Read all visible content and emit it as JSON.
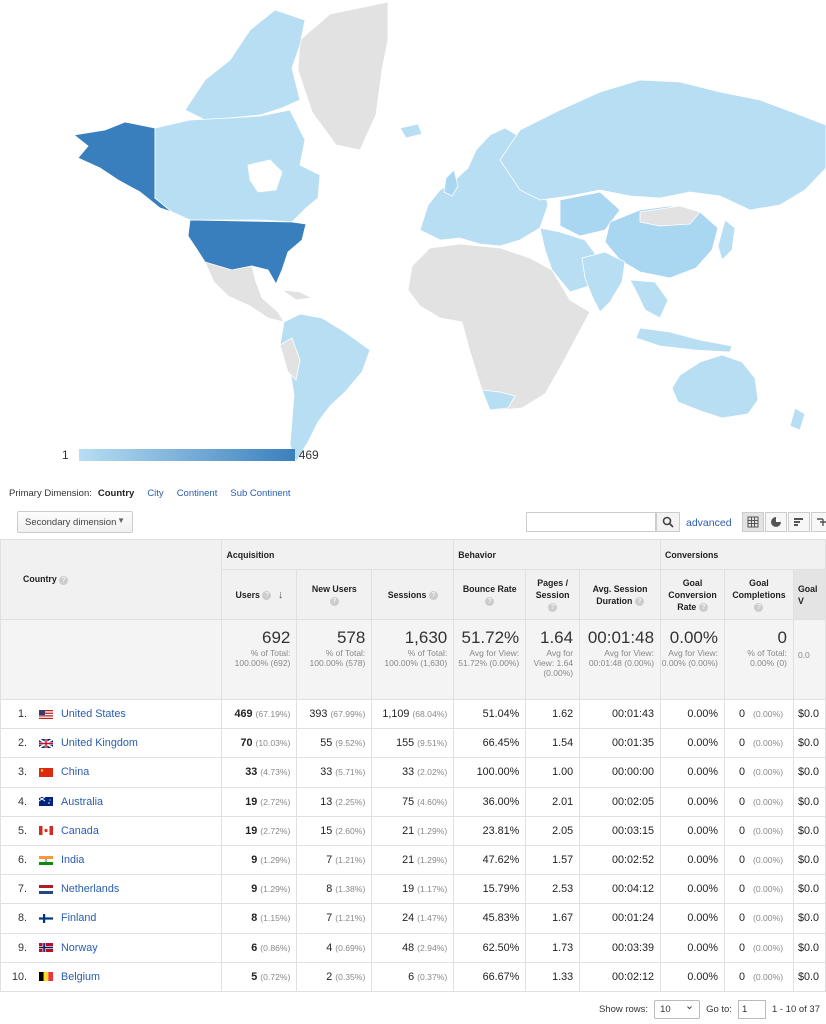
{
  "map": {
    "legend_min": "1",
    "legend_max": "469",
    "colors": {
      "ocean": "#ffffff",
      "nodata": "#e2e2e2",
      "low": "#b7def3",
      "mid": "#a9d6f0",
      "high": "#3a7fbd"
    }
  },
  "primary_dimension": {
    "label": "Primary Dimension:",
    "active": "Country",
    "options": [
      "City",
      "Continent",
      "Sub Continent"
    ]
  },
  "toolbar": {
    "secondary_dimension": "Secondary dimension",
    "search_value": "",
    "advanced": "advanced"
  },
  "table": {
    "country_header": "Country",
    "groups": [
      "Acquisition",
      "Behavior",
      "Conversions"
    ],
    "columns": [
      "Users",
      "New Users",
      "Sessions",
      "Bounce Rate",
      "Pages / Session",
      "Avg. Session Duration",
      "Goal Conversion Rate",
      "Goal Completions",
      "Goal V"
    ],
    "totals": [
      {
        "value": "692",
        "sub": "% of Total: 100.00% (692)"
      },
      {
        "value": "578",
        "sub": "% of Total: 100.00% (578)"
      },
      {
        "value": "1,630",
        "sub": "% of Total: 100.00% (1,630)"
      },
      {
        "value": "51.72%",
        "sub": "Avg for View: 51.72% (0.00%)"
      },
      {
        "value": "1.64",
        "sub": "Avg for View: 1.64 (0.00%)"
      },
      {
        "value": "00:01:48",
        "sub": "Avg for View: 00:01:48 (0.00%)"
      },
      {
        "value": "0.00%",
        "sub": "Avg for View: 0.00% (0.00%)"
      },
      {
        "value": "0",
        "sub": "% of Total: 0.00% (0)"
      },
      {
        "value": "",
        "sub": "0.0"
      }
    ],
    "rows": [
      {
        "num": "1.",
        "country": "United States",
        "users": "469",
        "users_pct": "(67.19%)",
        "new_users": "393",
        "new_users_pct": "(67.99%)",
        "sessions": "1,109",
        "sessions_pct": "(68.04%)",
        "bounce": "51.04%",
        "pages": "1.62",
        "duration": "00:01:43",
        "conv": "0.00%",
        "goal": "0",
        "goal_pct": "(0.00%)",
        "value": "$0.0"
      },
      {
        "num": "2.",
        "country": "United Kingdom",
        "users": "70",
        "users_pct": "(10.03%)",
        "new_users": "55",
        "new_users_pct": "(9.52%)",
        "sessions": "155",
        "sessions_pct": "(9.51%)",
        "bounce": "66.45%",
        "pages": "1.54",
        "duration": "00:01:35",
        "conv": "0.00%",
        "goal": "0",
        "goal_pct": "(0.00%)",
        "value": "$0.0"
      },
      {
        "num": "3.",
        "country": "China",
        "users": "33",
        "users_pct": "(4.73%)",
        "new_users": "33",
        "new_users_pct": "(5.71%)",
        "sessions": "33",
        "sessions_pct": "(2.02%)",
        "bounce": "100.00%",
        "pages": "1.00",
        "duration": "00:00:00",
        "conv": "0.00%",
        "goal": "0",
        "goal_pct": "(0.00%)",
        "value": "$0.0"
      },
      {
        "num": "4.",
        "country": "Australia",
        "users": "19",
        "users_pct": "(2.72%)",
        "new_users": "13",
        "new_users_pct": "(2.25%)",
        "sessions": "75",
        "sessions_pct": "(4.60%)",
        "bounce": "36.00%",
        "pages": "2.01",
        "duration": "00:02:05",
        "conv": "0.00%",
        "goal": "0",
        "goal_pct": "(0.00%)",
        "value": "$0.0"
      },
      {
        "num": "5.",
        "country": "Canada",
        "users": "19",
        "users_pct": "(2.72%)",
        "new_users": "15",
        "new_users_pct": "(2.60%)",
        "sessions": "21",
        "sessions_pct": "(1.29%)",
        "bounce": "23.81%",
        "pages": "2.05",
        "duration": "00:03:15",
        "conv": "0.00%",
        "goal": "0",
        "goal_pct": "(0.00%)",
        "value": "$0.0"
      },
      {
        "num": "6.",
        "country": "India",
        "users": "9",
        "users_pct": "(1.29%)",
        "new_users": "7",
        "new_users_pct": "(1.21%)",
        "sessions": "21",
        "sessions_pct": "(1.29%)",
        "bounce": "47.62%",
        "pages": "1.57",
        "duration": "00:02:52",
        "conv": "0.00%",
        "goal": "0",
        "goal_pct": "(0.00%)",
        "value": "$0.0"
      },
      {
        "num": "7.",
        "country": "Netherlands",
        "users": "9",
        "users_pct": "(1.29%)",
        "new_users": "8",
        "new_users_pct": "(1.38%)",
        "sessions": "19",
        "sessions_pct": "(1.17%)",
        "bounce": "15.79%",
        "pages": "2.53",
        "duration": "00:04:12",
        "conv": "0.00%",
        "goal": "0",
        "goal_pct": "(0.00%)",
        "value": "$0.0"
      },
      {
        "num": "8.",
        "country": "Finland",
        "users": "8",
        "users_pct": "(1.15%)",
        "new_users": "7",
        "new_users_pct": "(1.21%)",
        "sessions": "24",
        "sessions_pct": "(1.47%)",
        "bounce": "45.83%",
        "pages": "1.67",
        "duration": "00:01:24",
        "conv": "0.00%",
        "goal": "0",
        "goal_pct": "(0.00%)",
        "value": "$0.0"
      },
      {
        "num": "9.",
        "country": "Norway",
        "users": "6",
        "users_pct": "(0.86%)",
        "new_users": "4",
        "new_users_pct": "(0.69%)",
        "sessions": "48",
        "sessions_pct": "(2.94%)",
        "bounce": "62.50%",
        "pages": "1.73",
        "duration": "00:03:39",
        "conv": "0.00%",
        "goal": "0",
        "goal_pct": "(0.00%)",
        "value": "$0.0"
      },
      {
        "num": "10.",
        "country": "Belgium",
        "users": "5",
        "users_pct": "(0.72%)",
        "new_users": "2",
        "new_users_pct": "(0.35%)",
        "sessions": "6",
        "sessions_pct": "(0.37%)",
        "bounce": "66.67%",
        "pages": "1.33",
        "duration": "00:02:12",
        "conv": "0.00%",
        "goal": "0",
        "goal_pct": "(0.00%)",
        "value": "$0.0"
      }
    ]
  },
  "pager": {
    "show_rows_label": "Show rows:",
    "show_rows_value": "10",
    "goto_label": "Go to:",
    "goto_value": "1",
    "range": "1 - 10 of 37"
  }
}
